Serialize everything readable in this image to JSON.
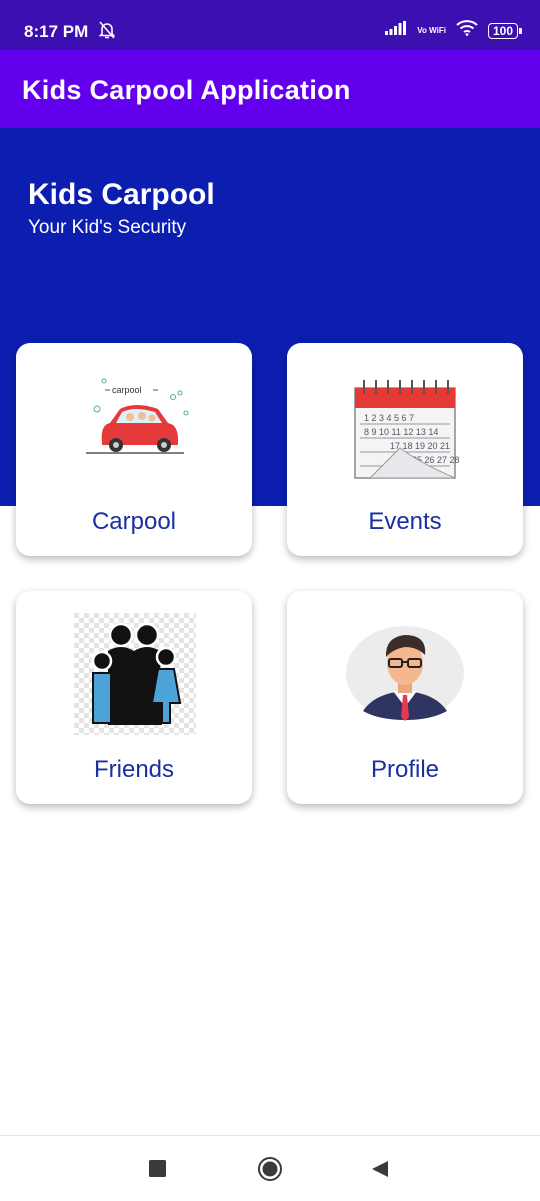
{
  "status_bar": {
    "time": "8:17 PM",
    "network_label": "Vo WiFi",
    "battery": "100"
  },
  "app_bar": {
    "title": "Kids Carpool Application"
  },
  "hero": {
    "title": "Kids Carpool",
    "subtitle": "Your Kid's Security"
  },
  "cards": [
    {
      "label": "Carpool",
      "icon": "carpool-car-icon",
      "image_text": "carpool"
    },
    {
      "label": "Events",
      "icon": "calendar-icon"
    },
    {
      "label": "Friends",
      "icon": "family-icon"
    },
    {
      "label": "Profile",
      "icon": "profile-avatar-icon"
    }
  ],
  "colors": {
    "status_bar": "#3b0fb0",
    "app_bar": "#6200ee",
    "hero": "#0b1eb0",
    "card_label": "#1a2fa0"
  }
}
